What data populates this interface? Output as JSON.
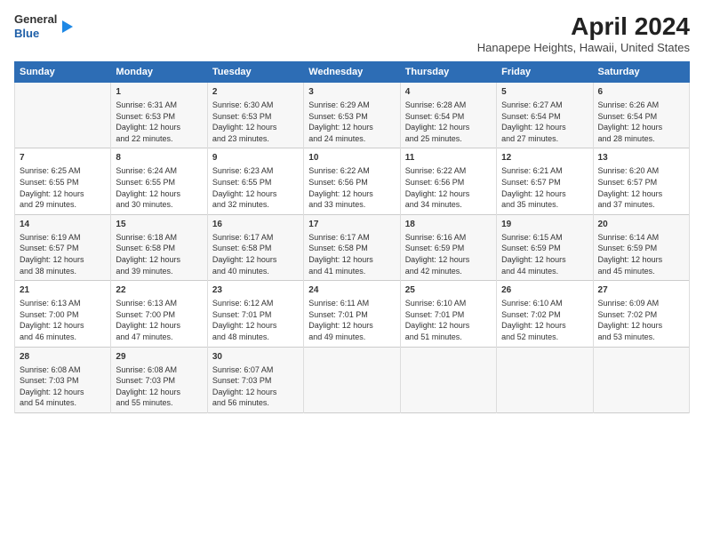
{
  "logo": {
    "general": "General",
    "blue": "Blue"
  },
  "title": "April 2024",
  "subtitle": "Hanapepe Heights, Hawaii, United States",
  "headers": [
    "Sunday",
    "Monday",
    "Tuesday",
    "Wednesday",
    "Thursday",
    "Friday",
    "Saturday"
  ],
  "weeks": [
    [
      {
        "day": "",
        "info": ""
      },
      {
        "day": "1",
        "info": "Sunrise: 6:31 AM\nSunset: 6:53 PM\nDaylight: 12 hours\nand 22 minutes."
      },
      {
        "day": "2",
        "info": "Sunrise: 6:30 AM\nSunset: 6:53 PM\nDaylight: 12 hours\nand 23 minutes."
      },
      {
        "day": "3",
        "info": "Sunrise: 6:29 AM\nSunset: 6:53 PM\nDaylight: 12 hours\nand 24 minutes."
      },
      {
        "day": "4",
        "info": "Sunrise: 6:28 AM\nSunset: 6:54 PM\nDaylight: 12 hours\nand 25 minutes."
      },
      {
        "day": "5",
        "info": "Sunrise: 6:27 AM\nSunset: 6:54 PM\nDaylight: 12 hours\nand 27 minutes."
      },
      {
        "day": "6",
        "info": "Sunrise: 6:26 AM\nSunset: 6:54 PM\nDaylight: 12 hours\nand 28 minutes."
      }
    ],
    [
      {
        "day": "7",
        "info": "Sunrise: 6:25 AM\nSunset: 6:55 PM\nDaylight: 12 hours\nand 29 minutes."
      },
      {
        "day": "8",
        "info": "Sunrise: 6:24 AM\nSunset: 6:55 PM\nDaylight: 12 hours\nand 30 minutes."
      },
      {
        "day": "9",
        "info": "Sunrise: 6:23 AM\nSunset: 6:55 PM\nDaylight: 12 hours\nand 32 minutes."
      },
      {
        "day": "10",
        "info": "Sunrise: 6:22 AM\nSunset: 6:56 PM\nDaylight: 12 hours\nand 33 minutes."
      },
      {
        "day": "11",
        "info": "Sunrise: 6:22 AM\nSunset: 6:56 PM\nDaylight: 12 hours\nand 34 minutes."
      },
      {
        "day": "12",
        "info": "Sunrise: 6:21 AM\nSunset: 6:57 PM\nDaylight: 12 hours\nand 35 minutes."
      },
      {
        "day": "13",
        "info": "Sunrise: 6:20 AM\nSunset: 6:57 PM\nDaylight: 12 hours\nand 37 minutes."
      }
    ],
    [
      {
        "day": "14",
        "info": "Sunrise: 6:19 AM\nSunset: 6:57 PM\nDaylight: 12 hours\nand 38 minutes."
      },
      {
        "day": "15",
        "info": "Sunrise: 6:18 AM\nSunset: 6:58 PM\nDaylight: 12 hours\nand 39 minutes."
      },
      {
        "day": "16",
        "info": "Sunrise: 6:17 AM\nSunset: 6:58 PM\nDaylight: 12 hours\nand 40 minutes."
      },
      {
        "day": "17",
        "info": "Sunrise: 6:17 AM\nSunset: 6:58 PM\nDaylight: 12 hours\nand 41 minutes."
      },
      {
        "day": "18",
        "info": "Sunrise: 6:16 AM\nSunset: 6:59 PM\nDaylight: 12 hours\nand 42 minutes."
      },
      {
        "day": "19",
        "info": "Sunrise: 6:15 AM\nSunset: 6:59 PM\nDaylight: 12 hours\nand 44 minutes."
      },
      {
        "day": "20",
        "info": "Sunrise: 6:14 AM\nSunset: 6:59 PM\nDaylight: 12 hours\nand 45 minutes."
      }
    ],
    [
      {
        "day": "21",
        "info": "Sunrise: 6:13 AM\nSunset: 7:00 PM\nDaylight: 12 hours\nand 46 minutes."
      },
      {
        "day": "22",
        "info": "Sunrise: 6:13 AM\nSunset: 7:00 PM\nDaylight: 12 hours\nand 47 minutes."
      },
      {
        "day": "23",
        "info": "Sunrise: 6:12 AM\nSunset: 7:01 PM\nDaylight: 12 hours\nand 48 minutes."
      },
      {
        "day": "24",
        "info": "Sunrise: 6:11 AM\nSunset: 7:01 PM\nDaylight: 12 hours\nand 49 minutes."
      },
      {
        "day": "25",
        "info": "Sunrise: 6:10 AM\nSunset: 7:01 PM\nDaylight: 12 hours\nand 51 minutes."
      },
      {
        "day": "26",
        "info": "Sunrise: 6:10 AM\nSunset: 7:02 PM\nDaylight: 12 hours\nand 52 minutes."
      },
      {
        "day": "27",
        "info": "Sunrise: 6:09 AM\nSunset: 7:02 PM\nDaylight: 12 hours\nand 53 minutes."
      }
    ],
    [
      {
        "day": "28",
        "info": "Sunrise: 6:08 AM\nSunset: 7:03 PM\nDaylight: 12 hours\nand 54 minutes."
      },
      {
        "day": "29",
        "info": "Sunrise: 6:08 AM\nSunset: 7:03 PM\nDaylight: 12 hours\nand 55 minutes."
      },
      {
        "day": "30",
        "info": "Sunrise: 6:07 AM\nSunset: 7:03 PM\nDaylight: 12 hours\nand 56 minutes."
      },
      {
        "day": "",
        "info": ""
      },
      {
        "day": "",
        "info": ""
      },
      {
        "day": "",
        "info": ""
      },
      {
        "day": "",
        "info": ""
      }
    ]
  ]
}
